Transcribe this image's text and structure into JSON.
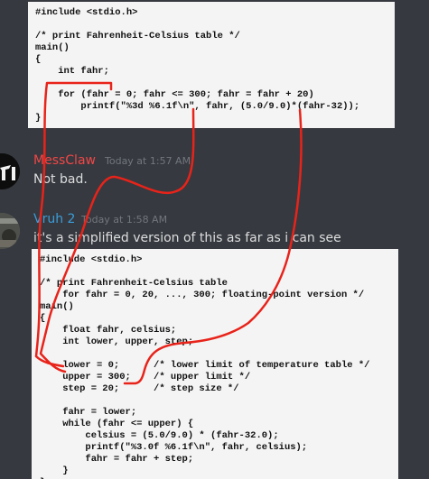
{
  "code_top": {
    "lines": [
      "#include <stdio.h>",
      "",
      "/* print Fahrenheit-Celsius table */",
      "main()",
      "{",
      "    int fahr;",
      "",
      "    for (fahr = 0; fahr <= 300; fahr = fahr + 20)",
      "        printf(\"%3d %6.1f\\n\", fahr, (5.0/9.0)*(fahr-32));",
      "}"
    ]
  },
  "messages": [
    {
      "username": "MessClaw",
      "timestamp": "Today at 1:57 AM",
      "text": "Not bad.",
      "username_color": "#f04747"
    },
    {
      "username": "Vruh 2",
      "timestamp": "Today at 1:58 AM",
      "text": "it's a simplified version of this as far as i can see",
      "username_color": "#3b9dd9"
    }
  ],
  "code_bottom": {
    "lines": [
      "#include <stdio.h>",
      "",
      "/* print Fahrenheit-Celsius table",
      "    for fahr = 0, 20, ..., 300; floating-point version */",
      "main()",
      "{",
      "    float fahr, celsius;",
      "    int lower, upper, step;",
      "",
      "    lower = 0;      /* lower limit of temperature table */",
      "    upper = 300;    /* upper limit */",
      "    step = 20;      /* step size */",
      "",
      "    fahr = lower;",
      "    while (fahr <= upper) {",
      "        celsius = (5.0/9.0) * (fahr-32.0);",
      "        printf(\"%3.0f %6.1f\\n\", fahr, celsius);",
      "        fahr = fahr + step;",
      "    }",
      "}"
    ]
  },
  "colors": {
    "background": "#36393f",
    "annotation": "#e8231a"
  }
}
